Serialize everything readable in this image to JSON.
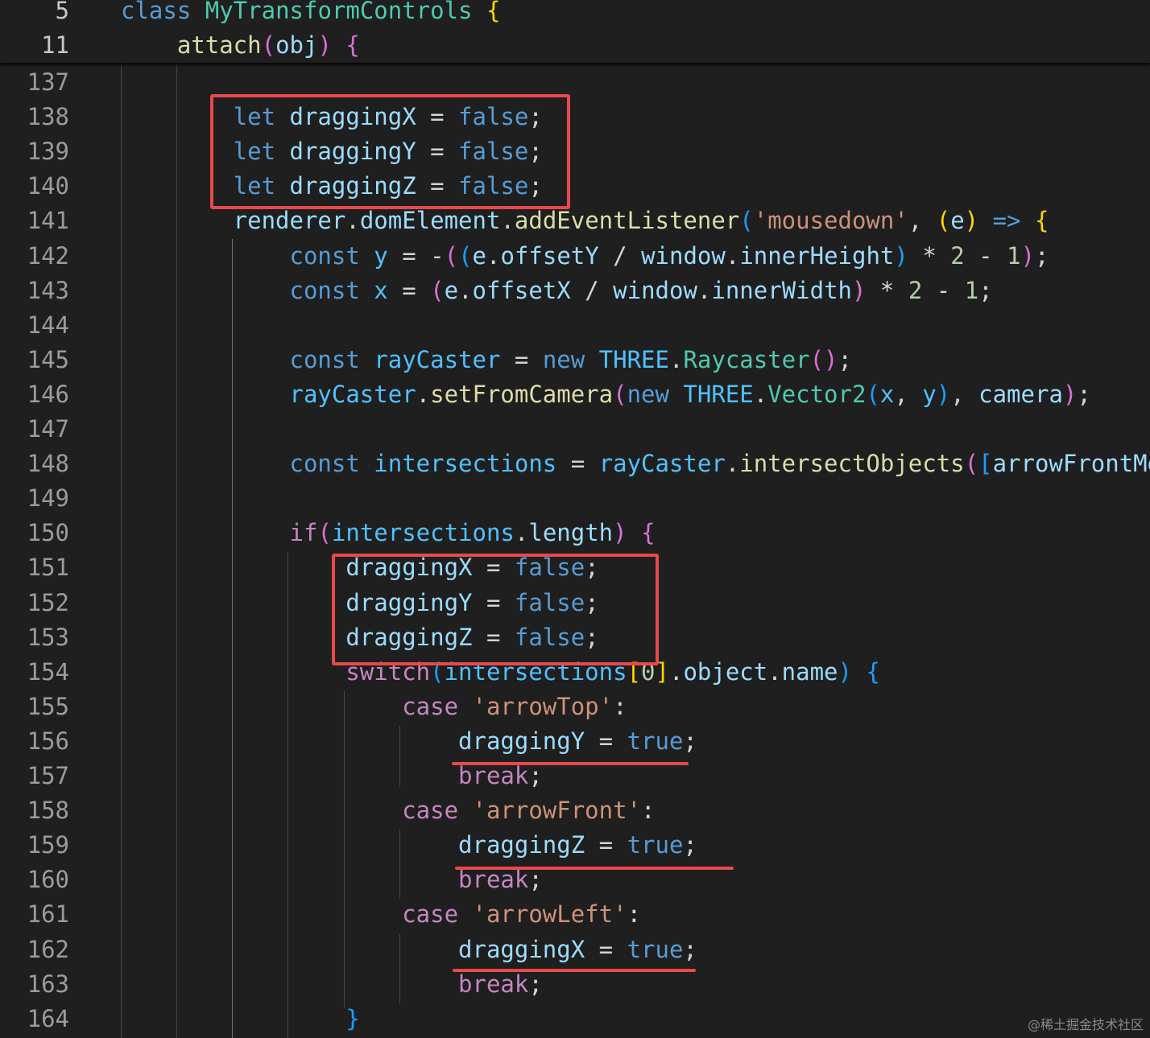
{
  "colors": {
    "background": "#1f1f1f",
    "line_number": "#9b9b9b",
    "keyword_blue": "#569cd6",
    "keyword_pink": "#c586c0",
    "class_name": "#4ec9b0",
    "function": "#dcdcaa",
    "variable": "#9cdcfe",
    "constant": "#4fc1ff",
    "string": "#ce9178",
    "number": "#b5cea8",
    "operator": "#d4d4d4",
    "bracket_gold": "#ffd700",
    "bracket_pink": "#da70d6",
    "bracket_blue": "#179fff",
    "annotation_red": "#e8494c"
  },
  "sticky_header": [
    {
      "line": "5",
      "tokens": [
        [
          "class ",
          "keyword_blue"
        ],
        [
          "MyTransformControls",
          "class_name"
        ],
        [
          " ",
          "operator"
        ],
        [
          "{",
          "bracket_gold"
        ]
      ]
    },
    {
      "line": "11",
      "tokens": [
        [
          "    attach",
          "function"
        ],
        [
          "(",
          "bracket_pink"
        ],
        [
          "obj",
          "variable"
        ],
        [
          ")",
          "bracket_pink"
        ],
        [
          " ",
          "operator"
        ],
        [
          "{",
          "bracket_pink"
        ]
      ]
    }
  ],
  "code_lines": [
    {
      "line": "137",
      "tokens": []
    },
    {
      "line": "138",
      "tokens": [
        [
          "        let ",
          "keyword_blue"
        ],
        [
          "draggingX",
          "variable"
        ],
        [
          " = ",
          "operator"
        ],
        [
          "false",
          "keyword_blue"
        ],
        [
          ";",
          "operator"
        ]
      ]
    },
    {
      "line": "139",
      "tokens": [
        [
          "        let ",
          "keyword_blue"
        ],
        [
          "draggingY",
          "variable"
        ],
        [
          " = ",
          "operator"
        ],
        [
          "false",
          "keyword_blue"
        ],
        [
          ";",
          "operator"
        ]
      ]
    },
    {
      "line": "140",
      "tokens": [
        [
          "        let ",
          "keyword_blue"
        ],
        [
          "draggingZ",
          "variable"
        ],
        [
          " = ",
          "operator"
        ],
        [
          "false",
          "keyword_blue"
        ],
        [
          ";",
          "operator"
        ]
      ]
    },
    {
      "line": "141",
      "tokens": [
        [
          "        renderer",
          "variable"
        ],
        [
          ".",
          "operator"
        ],
        [
          "domElement",
          "variable"
        ],
        [
          ".",
          "operator"
        ],
        [
          "addEventListener",
          "function"
        ],
        [
          "(",
          "bracket_blue"
        ],
        [
          "'mousedown'",
          "string"
        ],
        [
          ", ",
          "operator"
        ],
        [
          "(",
          "bracket_gold"
        ],
        [
          "e",
          "variable"
        ],
        [
          ")",
          "bracket_gold"
        ],
        [
          " ",
          "operator"
        ],
        [
          "=>",
          "keyword_blue"
        ],
        [
          " ",
          "operator"
        ],
        [
          "{",
          "bracket_gold"
        ]
      ]
    },
    {
      "line": "142",
      "tokens": [
        [
          "            const ",
          "keyword_blue"
        ],
        [
          "y",
          "constant"
        ],
        [
          " = ",
          "operator"
        ],
        [
          "-",
          "operator"
        ],
        [
          "(",
          "bracket_pink"
        ],
        [
          "(",
          "bracket_blue"
        ],
        [
          "e",
          "variable"
        ],
        [
          ".",
          "operator"
        ],
        [
          "offsetY",
          "variable"
        ],
        [
          " / ",
          "operator"
        ],
        [
          "window",
          "variable"
        ],
        [
          ".",
          "operator"
        ],
        [
          "innerHeight",
          "variable"
        ],
        [
          ")",
          "bracket_blue"
        ],
        [
          " * ",
          "operator"
        ],
        [
          "2",
          "number"
        ],
        [
          " - ",
          "operator"
        ],
        [
          "1",
          "number"
        ],
        [
          ")",
          "bracket_pink"
        ],
        [
          ";",
          "operator"
        ]
      ]
    },
    {
      "line": "143",
      "tokens": [
        [
          "            const ",
          "keyword_blue"
        ],
        [
          "x",
          "constant"
        ],
        [
          " = ",
          "operator"
        ],
        [
          "(",
          "bracket_pink"
        ],
        [
          "e",
          "variable"
        ],
        [
          ".",
          "operator"
        ],
        [
          "offsetX",
          "variable"
        ],
        [
          " / ",
          "operator"
        ],
        [
          "window",
          "variable"
        ],
        [
          ".",
          "operator"
        ],
        [
          "innerWidth",
          "variable"
        ],
        [
          ")",
          "bracket_pink"
        ],
        [
          " * ",
          "operator"
        ],
        [
          "2",
          "number"
        ],
        [
          " - ",
          "operator"
        ],
        [
          "1",
          "number"
        ],
        [
          ";",
          "operator"
        ]
      ]
    },
    {
      "line": "144",
      "tokens": []
    },
    {
      "line": "145",
      "tokens": [
        [
          "            const ",
          "keyword_blue"
        ],
        [
          "rayCaster",
          "constant"
        ],
        [
          " = ",
          "operator"
        ],
        [
          "new ",
          "keyword_blue"
        ],
        [
          "THREE",
          "constant"
        ],
        [
          ".",
          "operator"
        ],
        [
          "Raycaster",
          "class_name"
        ],
        [
          "(",
          "bracket_pink"
        ],
        [
          ")",
          "bracket_pink"
        ],
        [
          ";",
          "operator"
        ]
      ]
    },
    {
      "line": "146",
      "tokens": [
        [
          "            rayCaster",
          "constant"
        ],
        [
          ".",
          "operator"
        ],
        [
          "setFromCamera",
          "function"
        ],
        [
          "(",
          "bracket_pink"
        ],
        [
          "new ",
          "keyword_blue"
        ],
        [
          "THREE",
          "constant"
        ],
        [
          ".",
          "operator"
        ],
        [
          "Vector2",
          "class_name"
        ],
        [
          "(",
          "bracket_blue"
        ],
        [
          "x",
          "constant"
        ],
        [
          ", ",
          "operator"
        ],
        [
          "y",
          "constant"
        ],
        [
          ")",
          "bracket_blue"
        ],
        [
          ", ",
          "operator"
        ],
        [
          "camera",
          "variable"
        ],
        [
          ")",
          "bracket_pink"
        ],
        [
          ";",
          "operator"
        ]
      ]
    },
    {
      "line": "147",
      "tokens": []
    },
    {
      "line": "148",
      "tokens": [
        [
          "            const ",
          "keyword_blue"
        ],
        [
          "intersections",
          "constant"
        ],
        [
          " = ",
          "operator"
        ],
        [
          "rayCaster",
          "constant"
        ],
        [
          ".",
          "operator"
        ],
        [
          "intersectObjects",
          "function"
        ],
        [
          "(",
          "bracket_pink"
        ],
        [
          "[",
          "bracket_blue"
        ],
        [
          "arrowFrontMe",
          "variable"
        ]
      ]
    },
    {
      "line": "149",
      "tokens": []
    },
    {
      "line": "150",
      "tokens": [
        [
          "            if",
          "keyword_pink"
        ],
        [
          "(",
          "bracket_pink"
        ],
        [
          "intersections",
          "constant"
        ],
        [
          ".",
          "operator"
        ],
        [
          "length",
          "variable"
        ],
        [
          ")",
          "bracket_pink"
        ],
        [
          " ",
          "operator"
        ],
        [
          "{",
          "bracket_pink"
        ]
      ]
    },
    {
      "line": "151",
      "tokens": [
        [
          "                draggingX",
          "variable"
        ],
        [
          " = ",
          "operator"
        ],
        [
          "false",
          "keyword_blue"
        ],
        [
          ";",
          "operator"
        ]
      ]
    },
    {
      "line": "152",
      "tokens": [
        [
          "                draggingY",
          "variable"
        ],
        [
          " = ",
          "operator"
        ],
        [
          "false",
          "keyword_blue"
        ],
        [
          ";",
          "operator"
        ]
      ]
    },
    {
      "line": "153",
      "tokens": [
        [
          "                draggingZ",
          "variable"
        ],
        [
          " = ",
          "operator"
        ],
        [
          "false",
          "keyword_blue"
        ],
        [
          ";",
          "operator"
        ]
      ]
    },
    {
      "line": "154",
      "tokens": [
        [
          "                switch",
          "keyword_pink"
        ],
        [
          "(",
          "bracket_blue"
        ],
        [
          "intersections",
          "constant"
        ],
        [
          "[",
          "bracket_gold"
        ],
        [
          "0",
          "number"
        ],
        [
          "]",
          "bracket_gold"
        ],
        [
          ".",
          "operator"
        ],
        [
          "object",
          "variable"
        ],
        [
          ".",
          "operator"
        ],
        [
          "name",
          "variable"
        ],
        [
          ")",
          "bracket_blue"
        ],
        [
          " ",
          "operator"
        ],
        [
          "{",
          "bracket_blue"
        ]
      ]
    },
    {
      "line": "155",
      "tokens": [
        [
          "                    case ",
          "keyword_pink"
        ],
        [
          "'arrowTop'",
          "string"
        ],
        [
          ":",
          "operator"
        ]
      ]
    },
    {
      "line": "156",
      "tokens": [
        [
          "                        draggingY",
          "variable"
        ],
        [
          " = ",
          "operator"
        ],
        [
          "true",
          "keyword_blue"
        ],
        [
          ";",
          "operator"
        ]
      ]
    },
    {
      "line": "157",
      "tokens": [
        [
          "                        break",
          "keyword_pink"
        ],
        [
          ";",
          "operator"
        ]
      ]
    },
    {
      "line": "158",
      "tokens": [
        [
          "                    case ",
          "keyword_pink"
        ],
        [
          "'arrowFront'",
          "string"
        ],
        [
          ":",
          "operator"
        ]
      ]
    },
    {
      "line": "159",
      "tokens": [
        [
          "                        draggingZ",
          "variable"
        ],
        [
          " = ",
          "operator"
        ],
        [
          "true",
          "keyword_blue"
        ],
        [
          ";",
          "operator"
        ]
      ]
    },
    {
      "line": "160",
      "tokens": [
        [
          "                        break",
          "keyword_pink"
        ],
        [
          ";",
          "operator"
        ]
      ]
    },
    {
      "line": "161",
      "tokens": [
        [
          "                    case ",
          "keyword_pink"
        ],
        [
          "'arrowLeft'",
          "string"
        ],
        [
          ":",
          "operator"
        ]
      ]
    },
    {
      "line": "162",
      "tokens": [
        [
          "                        draggingX",
          "variable"
        ],
        [
          " = ",
          "operator"
        ],
        [
          "true",
          "keyword_blue"
        ],
        [
          ";",
          "operator"
        ]
      ]
    },
    {
      "line": "163",
      "tokens": [
        [
          "                        break",
          "keyword_pink"
        ],
        [
          ";",
          "operator"
        ]
      ]
    },
    {
      "line": "164",
      "tokens": [
        [
          "                ",
          "operator"
        ],
        [
          "}",
          "bracket_blue"
        ]
      ]
    }
  ],
  "watermark": "@稀土掘金技术社区"
}
